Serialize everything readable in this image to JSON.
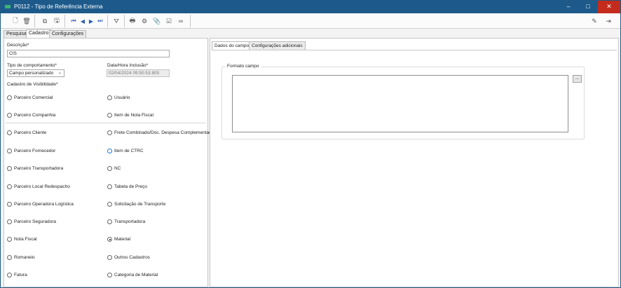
{
  "window": {
    "title": "P0112 - Tipo de Referência Externa",
    "min": "–",
    "max": "□",
    "close": "✕"
  },
  "toolbar": {
    "icons": {
      "new": "🗋",
      "delete": "🗑",
      "copy": "⧉",
      "save": "🖫",
      "first": "⏮",
      "prev": "◀",
      "next": "▶",
      "last": "⏭",
      "filter": "⛛",
      "print": "🖶",
      "settings": "⚙",
      "attach": "📎",
      "check": "☑",
      "link": "∞",
      "tool": "✎",
      "exit": "⇥"
    }
  },
  "tabs": [
    "Pesquisa",
    "Cadastro",
    "Configurações"
  ],
  "form": {
    "descricao_label": "Descrição*",
    "descricao_value": "CIS",
    "tipo_label": "Tipo de comportamento*",
    "tipo_value": "Campo personalizado",
    "data_label": "Data/Hora Inclusão*",
    "data_value": "02/04/2024 09:50:53.805",
    "visibilidade_label": "Cadastro de Visibilidade*"
  },
  "radios_left": [
    "Parceiro Comercial",
    "Parceiro Companhia",
    "Parceiro Cliente",
    "Parceiro Fornecedor",
    "Parceiro Transportadora",
    "Parceiro Local Redespacho",
    "Parceiro Operadora Logística",
    "Parceiro Seguradora",
    "Nota Fiscal",
    "Romaneio",
    "Fatura"
  ],
  "radios_right": [
    "Usuário",
    "Item de Nota Fiscal",
    "Frete Combinado/Doc. Despesa Complementar",
    "Item de CTRC",
    "NC",
    "Tabela de Preço",
    "Solicitação de Transporte",
    "Transportadora",
    "Material",
    "Outros Cadastros",
    "Categoria de Material"
  ],
  "right_tabs": [
    "Dados do campo",
    "Configurações adicionais"
  ],
  "formato": {
    "legend": "Formato campo",
    "button": "..."
  }
}
